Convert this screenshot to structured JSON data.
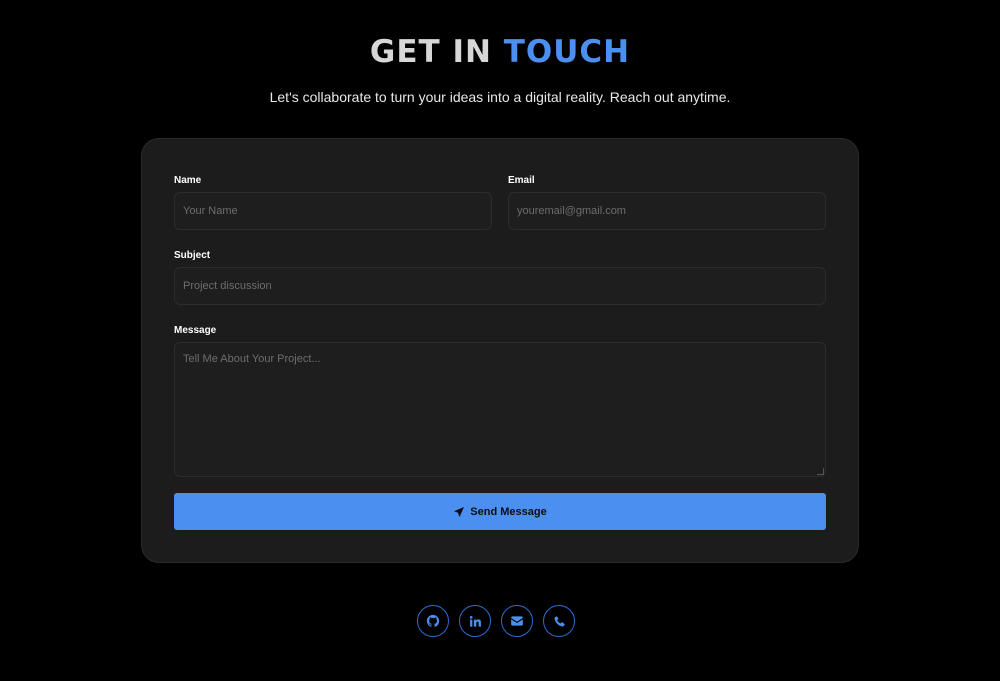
{
  "header": {
    "title_part1": "GET IN",
    "title_part2": "TOUCH",
    "subtitle": "Let's collaborate to turn your ideas into a digital reality. Reach out anytime."
  },
  "form": {
    "name": {
      "label": "Name",
      "placeholder": "Your Name",
      "value": ""
    },
    "email": {
      "label": "Email",
      "placeholder": "youremail@gmail.com",
      "value": ""
    },
    "subject": {
      "label": "Subject",
      "placeholder": "Project discussion",
      "value": ""
    },
    "message": {
      "label": "Message",
      "placeholder": "Tell Me About Your Project...",
      "value": ""
    },
    "submit_label": "Send Message",
    "submit_icon": "paper-plane-icon"
  },
  "socials": [
    {
      "icon": "github-icon"
    },
    {
      "icon": "linkedin-icon"
    },
    {
      "icon": "envelope-icon"
    },
    {
      "icon": "phone-icon"
    }
  ],
  "colors": {
    "background": "#000000",
    "card": "#1c1c1c",
    "accent": "#4b8ff0",
    "heading": "#d7d7d7"
  }
}
